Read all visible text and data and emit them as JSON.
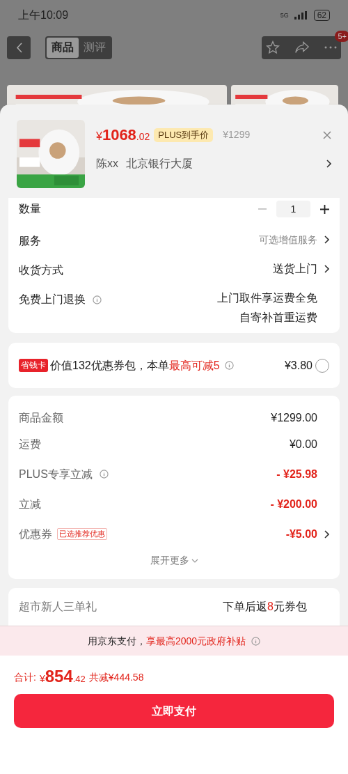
{
  "status_bar": {
    "time": "上午10:09",
    "network": "5G",
    "battery": "62"
  },
  "nav": {
    "tabs": [
      {
        "label": "商品",
        "selected": true
      },
      {
        "label": "测评",
        "selected": false
      }
    ],
    "badge": "5+"
  },
  "product": {
    "currency": "¥",
    "price_int": "1068",
    "price_dec": ".02",
    "plus_tag": "PLUS到手价",
    "original_price": "¥1299",
    "name": "陈xx",
    "address": "北京银行大厦"
  },
  "quantity": {
    "label": "数量",
    "value": "1"
  },
  "options": [
    {
      "label": "服务",
      "values": [
        "可选增值服务"
      ],
      "kind": "hint",
      "chevron": true,
      "info": false
    },
    {
      "label": "收货方式",
      "values": [
        "送货上门"
      ],
      "kind": "plain",
      "chevron": true,
      "info": false
    },
    {
      "label": "免费上门退换",
      "values": [
        "上门取件享运费全免",
        "自寄补首重运费"
      ],
      "kind": "plain",
      "chevron": false,
      "info": true
    }
  ],
  "savings": {
    "tag": "省钱卡",
    "text": "价值132优惠券包，本单",
    "highlight": "最高可减5",
    "price": "¥3.80",
    "selected": false
  },
  "summary": {
    "rows": [
      {
        "label": "商品金额",
        "value": "¥1299.00",
        "red": false,
        "info": false,
        "chevron": false
      },
      {
        "label": "运费",
        "value": "¥0.00",
        "red": false,
        "info": false,
        "chevron": false
      },
      {
        "label": "PLUS专享立减",
        "value": "- ¥25.98",
        "red": true,
        "info": true,
        "chevron": false
      },
      {
        "label": "立减",
        "value": "- ¥200.00",
        "red": true,
        "info": false,
        "chevron": false
      },
      {
        "label": "优惠券",
        "tag": "已选推荐优惠",
        "value": "-¥5.00",
        "red": true,
        "info": false,
        "chevron": true
      }
    ],
    "expand": "展开更多"
  },
  "gift": {
    "label": "超市新人三单礼",
    "value_before": "下单后返",
    "value_highlight": "8",
    "value_after": "元券包"
  },
  "banner": {
    "text": "用京东支付，",
    "highlight": "享最高2000元政府补贴"
  },
  "total": {
    "label": "合计:",
    "currency": "¥",
    "int": "854",
    "dec": ".42",
    "saved": "共减¥444.58"
  },
  "pay_button": "立即支付"
}
